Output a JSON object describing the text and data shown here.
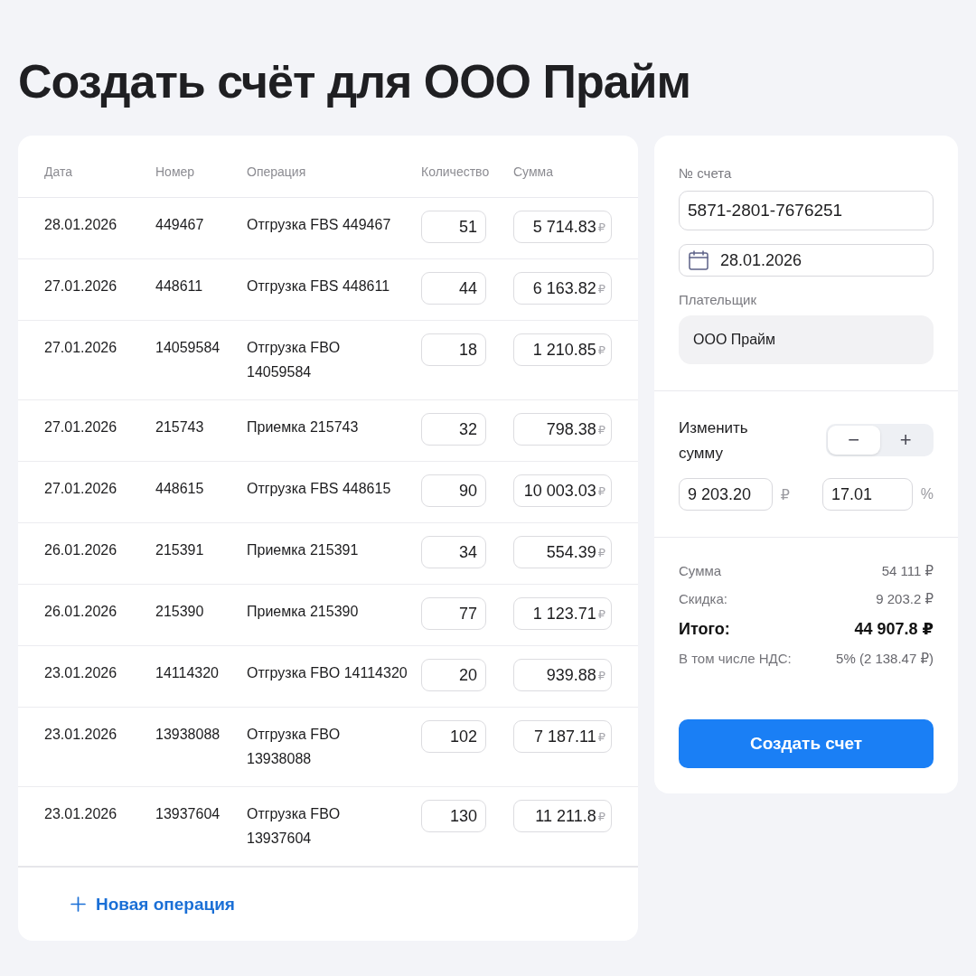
{
  "title": "Создать счёт для ООО Прайм",
  "table": {
    "columns": [
      "Дата",
      "Номер",
      "Операция",
      "Количество",
      "Сумма"
    ],
    "rows": [
      {
        "date": "28.01.2026",
        "number": "449467",
        "operation": "Отгрузка FBS 449467",
        "quantity": "51",
        "amount": "5 714.83",
        "currency": "₽"
      },
      {
        "date": "27.01.2026",
        "number": "448611",
        "operation": "Отгрузка FBS 448611",
        "quantity": "44",
        "amount": "6 163.82",
        "currency": "₽"
      },
      {
        "date": "27.01.2026",
        "number": "14059584",
        "operation": "Отгрузка FBO 14059584",
        "quantity": "18",
        "amount": "1 210.85",
        "currency": "₽"
      },
      {
        "date": "27.01.2026",
        "number": "215743",
        "operation": "Приемка 215743",
        "quantity": "32",
        "amount": "798.38",
        "currency": "₽"
      },
      {
        "date": "27.01.2026",
        "number": "448615",
        "operation": "Отгрузка FBS 448615",
        "quantity": "90",
        "amount": "10 003.03",
        "currency": "₽"
      },
      {
        "date": "26.01.2026",
        "number": "215391",
        "operation": "Приемка 215391",
        "quantity": "34",
        "amount": "554.39",
        "currency": "₽"
      },
      {
        "date": "26.01.2026",
        "number": "215390",
        "operation": "Приемка 215390",
        "quantity": "77",
        "amount": "1 123.71",
        "currency": "₽"
      },
      {
        "date": "23.01.2026",
        "number": "14114320",
        "operation": "Отгрузка FBO 14114320",
        "quantity": "20",
        "amount": "939.88",
        "currency": "₽"
      },
      {
        "date": "23.01.2026",
        "number": "13938088",
        "operation": "Отгрузка FBO 13938088",
        "quantity": "102",
        "amount": "7 187.11",
        "currency": "₽"
      },
      {
        "date": "23.01.2026",
        "number": "13937604",
        "operation": "Отгрузка FBO 13937604",
        "quantity": "130",
        "amount": "11 211.8",
        "currency": "₽"
      }
    ],
    "add_button": "Новая операция"
  },
  "invoice": {
    "number_label": "№ счета",
    "number": "5871-2801-7676251",
    "date": "28.01.2026",
    "payer_label": "Плательщик",
    "payer": "ООО Прайм",
    "adjust": {
      "label": "Изменить сумму",
      "modes": [
        {
          "symbol": "−",
          "selected": true
        },
        {
          "symbol": "+",
          "selected": false
        }
      ],
      "amount": {
        "value": "9 203.20",
        "unit": "₽"
      },
      "percent": {
        "value": "17.01",
        "unit": "%"
      }
    },
    "summary": [
      {
        "label": "Сумма",
        "value": "54 111 ₽",
        "kind": "line"
      },
      {
        "label": "Скидка:",
        "value": "9 203.2 ₽",
        "kind": "line"
      },
      {
        "label": "Итого:",
        "value": "44 907.8 ₽",
        "kind": "total"
      },
      {
        "label": "В том числе НДС:",
        "value": "5% (2 138.47 ₽)",
        "kind": "line"
      }
    ],
    "submit": "Создать счет"
  }
}
